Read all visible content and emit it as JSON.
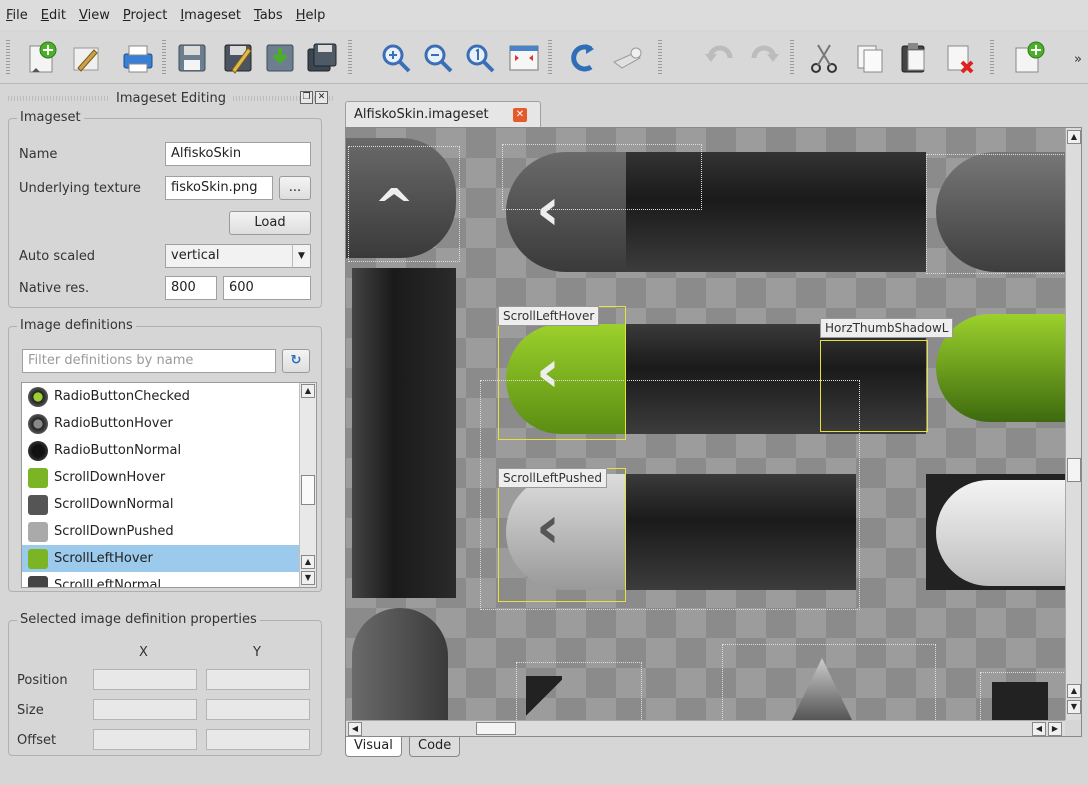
{
  "menubar": {
    "items": [
      {
        "label": "File"
      },
      {
        "label": "Edit"
      },
      {
        "label": "View"
      },
      {
        "label": "Project"
      },
      {
        "label": "Imageset"
      },
      {
        "label": "Tabs"
      },
      {
        "label": "Help"
      }
    ]
  },
  "toolbar": {
    "more_label": "»",
    "buttons": [
      "new-file-icon",
      "edit-pen-icon",
      "print-icon",
      "save-icon",
      "save-as-icon",
      "download-icon",
      "save-all-icon",
      "zoom-in-icon",
      "zoom-out-icon",
      "zoom-original-icon",
      "fit-view-icon",
      "reload-icon",
      "comment-icon",
      "undo-icon",
      "redo-icon",
      "cut-icon",
      "copy-icon",
      "paste-icon",
      "delete-icon",
      "new-definition-icon"
    ]
  },
  "dock": {
    "title": "Imageset Editing",
    "float_icon": "float-icon",
    "close_icon": "close-icon",
    "imageset": {
      "title": "Imageset",
      "name_label": "Name",
      "name_value": "AlfiskoSkin",
      "texture_label": "Underlying texture",
      "texture_value": "fiskoSkin.png",
      "browse_label": "...",
      "load_label": "Load",
      "auto_scaled_label": "Auto scaled",
      "auto_scaled_value": "vertical",
      "native_res_label": "Native res.",
      "native_res_x": "800",
      "native_res_y": "600"
    },
    "definitions": {
      "title": "Image definitions",
      "filter_placeholder": "Filter definitions by name",
      "items": [
        {
          "label": "RadioButtonChecked",
          "icon": "radio-checked-icon"
        },
        {
          "label": "RadioButtonHover",
          "icon": "radio-hover-icon"
        },
        {
          "label": "RadioButtonNormal",
          "icon": "radio-normal-icon"
        },
        {
          "label": "ScrollDownHover",
          "icon": "scroll-down-hover-icon"
        },
        {
          "label": "ScrollDownNormal",
          "icon": "scroll-down-normal-icon"
        },
        {
          "label": "ScrollDownPushed",
          "icon": "scroll-down-pushed-icon"
        },
        {
          "label": "ScrollLeftHover",
          "icon": "scroll-left-hover-icon"
        },
        {
          "label": "ScrollLeftNormal",
          "icon": "scroll-left-normal-icon"
        }
      ],
      "selected_index": 6
    },
    "properties": {
      "title": "Selected image definition properties",
      "col_x": "X",
      "col_y": "Y",
      "position_label": "Position",
      "size_label": "Size",
      "offset_label": "Offset"
    }
  },
  "editor": {
    "tab_label": "AlfiskoSkin.imageset",
    "labels": {
      "scroll_left_hover": "ScrollLeftHover",
      "horz_thumb_shadow": "HorzThumbShadowL",
      "scroll_left_pushed": "ScrollLeftPushed"
    },
    "bottom_tabs": [
      {
        "label": "Visual",
        "active": true
      },
      {
        "label": "Code",
        "active": false
      }
    ]
  },
  "colors": {
    "selection": "#e7e23a",
    "list_selected": "#9ccaec",
    "green_accent": "#8ac21e"
  }
}
